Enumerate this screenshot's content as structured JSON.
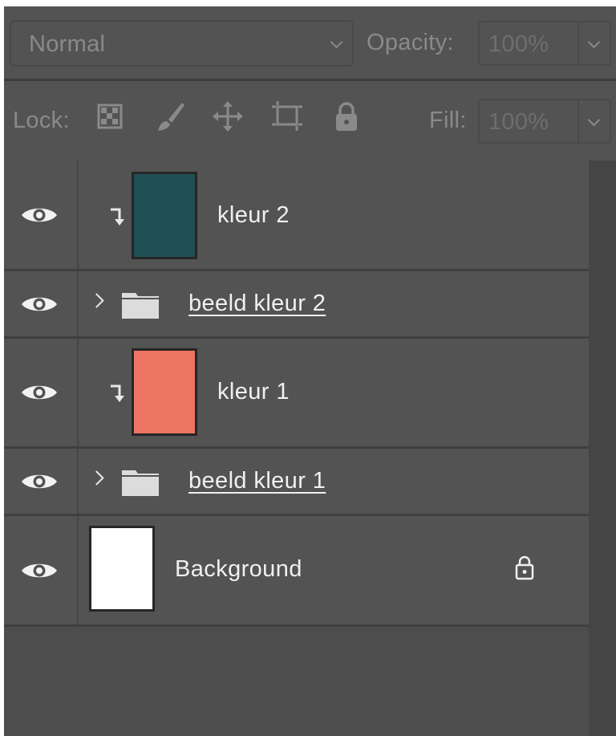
{
  "toolbar": {
    "blend_mode": "Normal",
    "opacity_label": "Opacity:",
    "opacity_value": "100%",
    "lock_label": "Lock:",
    "fill_label": "Fill:",
    "fill_value": "100%",
    "lock_icons": [
      "lock-transparent-pixels-icon",
      "lock-image-pixels-icon",
      "lock-position-icon",
      "lock-artboard-icon",
      "lock-all-icon"
    ]
  },
  "layers": [
    {
      "name": "kleur 2",
      "kind": "fill",
      "clipped": true,
      "visible": true,
      "color": "#1f5054"
    },
    {
      "name": "beeld kleur 2",
      "kind": "group",
      "collapsed": true,
      "visible": true
    },
    {
      "name": "kleur 1",
      "kind": "fill",
      "clipped": true,
      "visible": true,
      "color": "#ee7563"
    },
    {
      "name": "beeld kleur 1",
      "kind": "group",
      "collapsed": true,
      "visible": true
    },
    {
      "name": "Background",
      "kind": "background",
      "locked": true,
      "visible": true,
      "color": "#ffffff"
    }
  ],
  "colors": {
    "panel": "#535353",
    "list": "#4d4d4d",
    "text": "#f0f0f0",
    "disabled_text": "#8a8a8a"
  }
}
